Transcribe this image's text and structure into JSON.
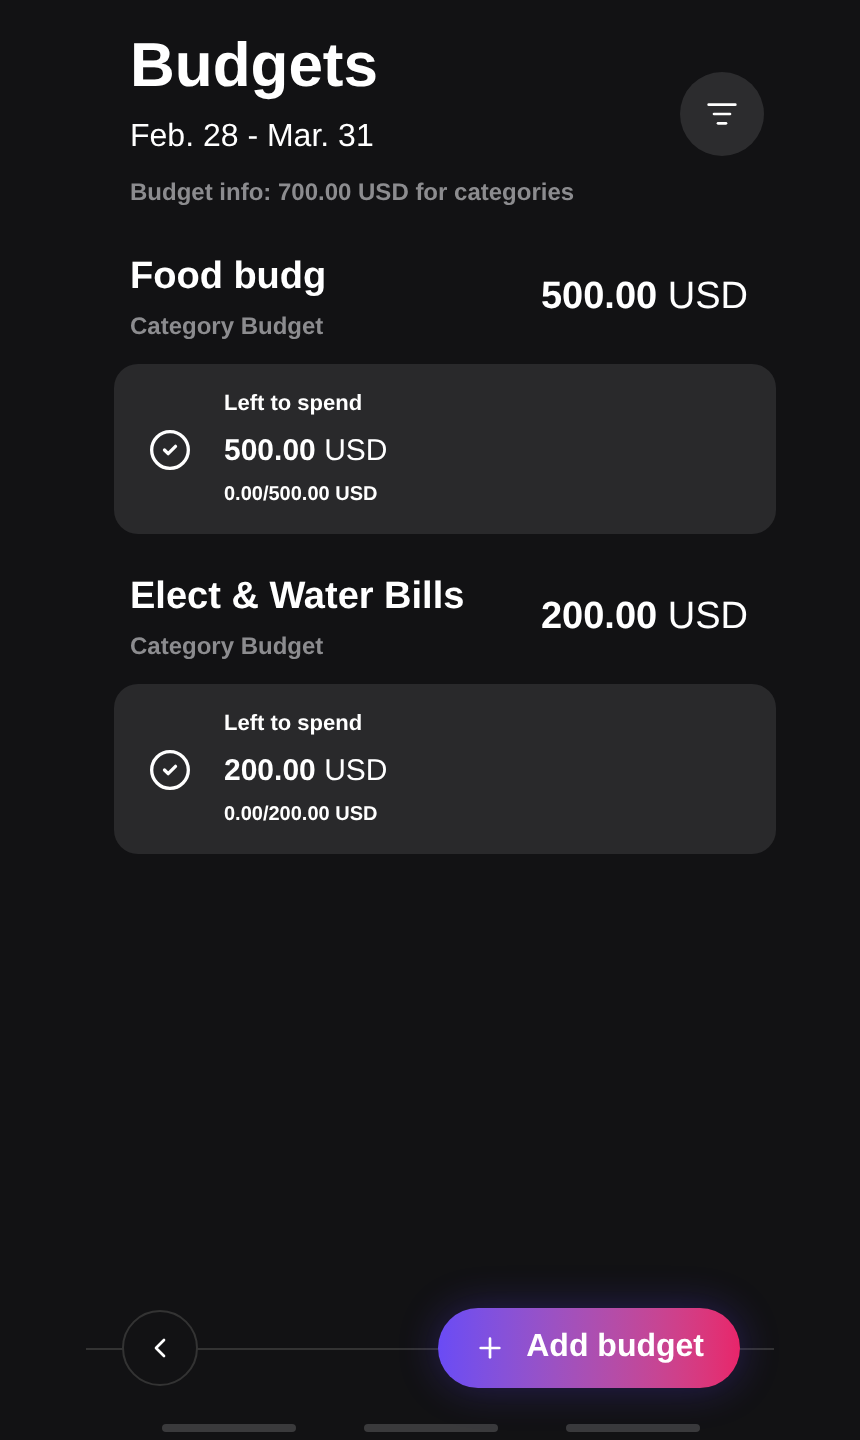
{
  "header": {
    "title": "Budgets",
    "period": "Feb. 28 - Mar. 31",
    "info": "Budget info: 700.00 USD for categories"
  },
  "budgets": [
    {
      "name": "Food budg",
      "type": "Category Budget",
      "amount": "500.00",
      "currency": "USD",
      "left_label": "Left to spend",
      "left_amount": "500.00",
      "left_currency": "USD",
      "progress": "0.00/500.00 USD"
    },
    {
      "name": "Elect & Water Bills",
      "type": "Category Budget",
      "amount": "200.00",
      "currency": "USD",
      "left_label": "Left to spend",
      "left_amount": "200.00",
      "left_currency": "USD",
      "progress": "0.00/200.00 USD"
    }
  ],
  "add_button": {
    "label": "Add budget"
  }
}
